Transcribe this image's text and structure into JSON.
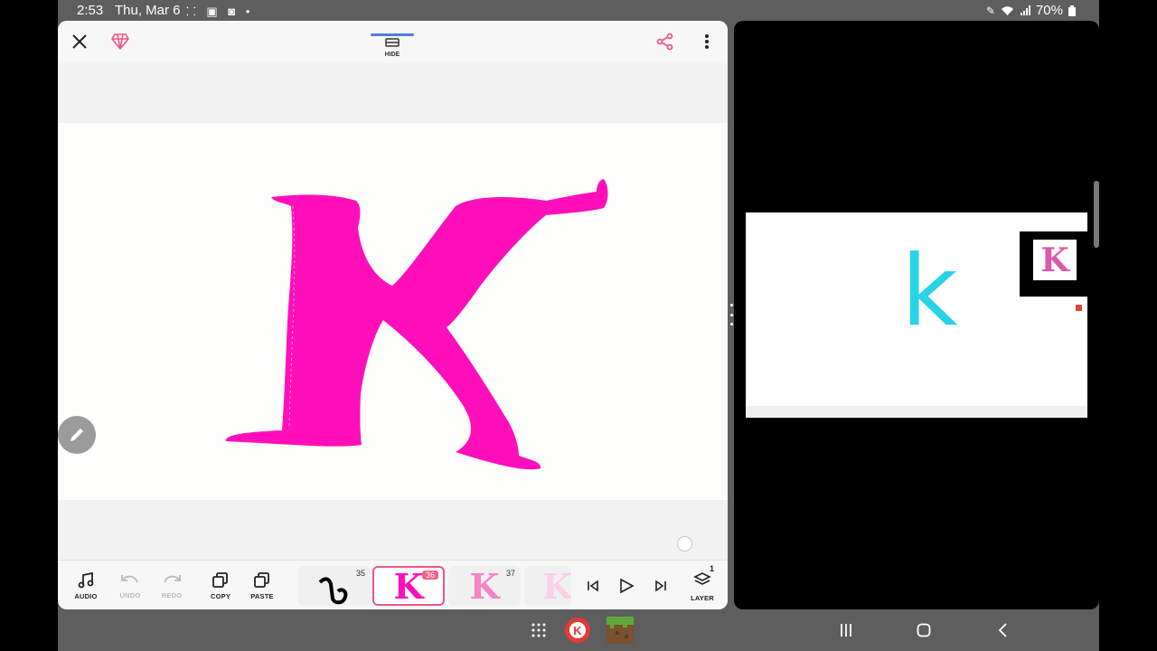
{
  "status_bar": {
    "time": "2:53",
    "date": "Thu, Mar 6",
    "battery": "70%"
  },
  "app": {
    "hide_label": "HIDE",
    "accent_color": "#f0558a",
    "drawing_color": "#ff0fb9"
  },
  "toolbar": {
    "audio_label": "AUDIO",
    "undo_label": "UNDO",
    "redo_label": "REDO",
    "copy_label": "COPY",
    "paste_label": "PASTE",
    "layer_label": "LAYER",
    "layer_count": "1"
  },
  "frames": [
    {
      "number": "35",
      "active": false
    },
    {
      "number": "36",
      "active": true
    },
    {
      "number": "37",
      "active": false
    }
  ],
  "video": {
    "letter": "k",
    "pip_letter": "K"
  }
}
